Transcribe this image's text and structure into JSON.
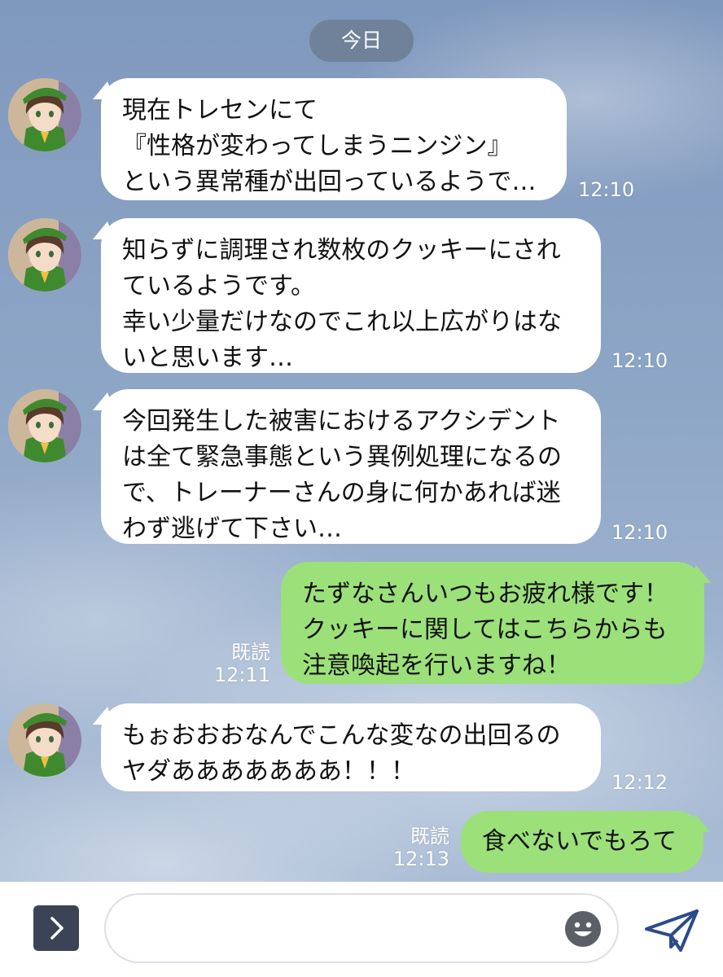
{
  "date_label": "今日",
  "messages": [
    {
      "lines": [
        "現在トレセンにて",
        "『性格が変わってしまうニンジン』",
        "という異常種が出回っているようで…"
      ],
      "time": "12:10"
    },
    {
      "lines": [
        "知らずに調理され数枚のクッキーにされ",
        "ているようです。",
        "幸い少量だけなのでこれ以上広がりはな",
        "いと思います…"
      ],
      "time": "12:10"
    },
    {
      "lines": [
        "今回発生した被害におけるアクシデント",
        "は全て緊急事態という異例処理になるの",
        "で、トレーナーさんの身に何かあれば迷",
        "わず逃げて下さい…"
      ],
      "time": "12:10"
    },
    {
      "lines": [
        "たずなさんいつもお疲れ様です！",
        "クッキーに関してはこちらからも",
        "注意喚起を行いますね！"
      ],
      "read": "既読",
      "time": "12:11"
    },
    {
      "lines": [
        "もぉおおおなんでこんな変なの出回るの",
        "ヤダあああああああ！！！"
      ],
      "time": "12:12"
    },
    {
      "lines": [
        "食べないでもろて"
      ],
      "read": "既読",
      "time": "12:13"
    }
  ],
  "input": {
    "value": "",
    "placeholder": ""
  },
  "icons": {
    "expand": "chevron-right-icon",
    "emoji": "smiley-icon",
    "send": "paper-plane-icon"
  },
  "colors": {
    "incoming_bubble": "#ffffff",
    "outgoing_bubble": "#9ce07a",
    "date_pill": "#6f8299",
    "expand_button": "#3c4356",
    "send_icon": "#2b4a8a"
  }
}
